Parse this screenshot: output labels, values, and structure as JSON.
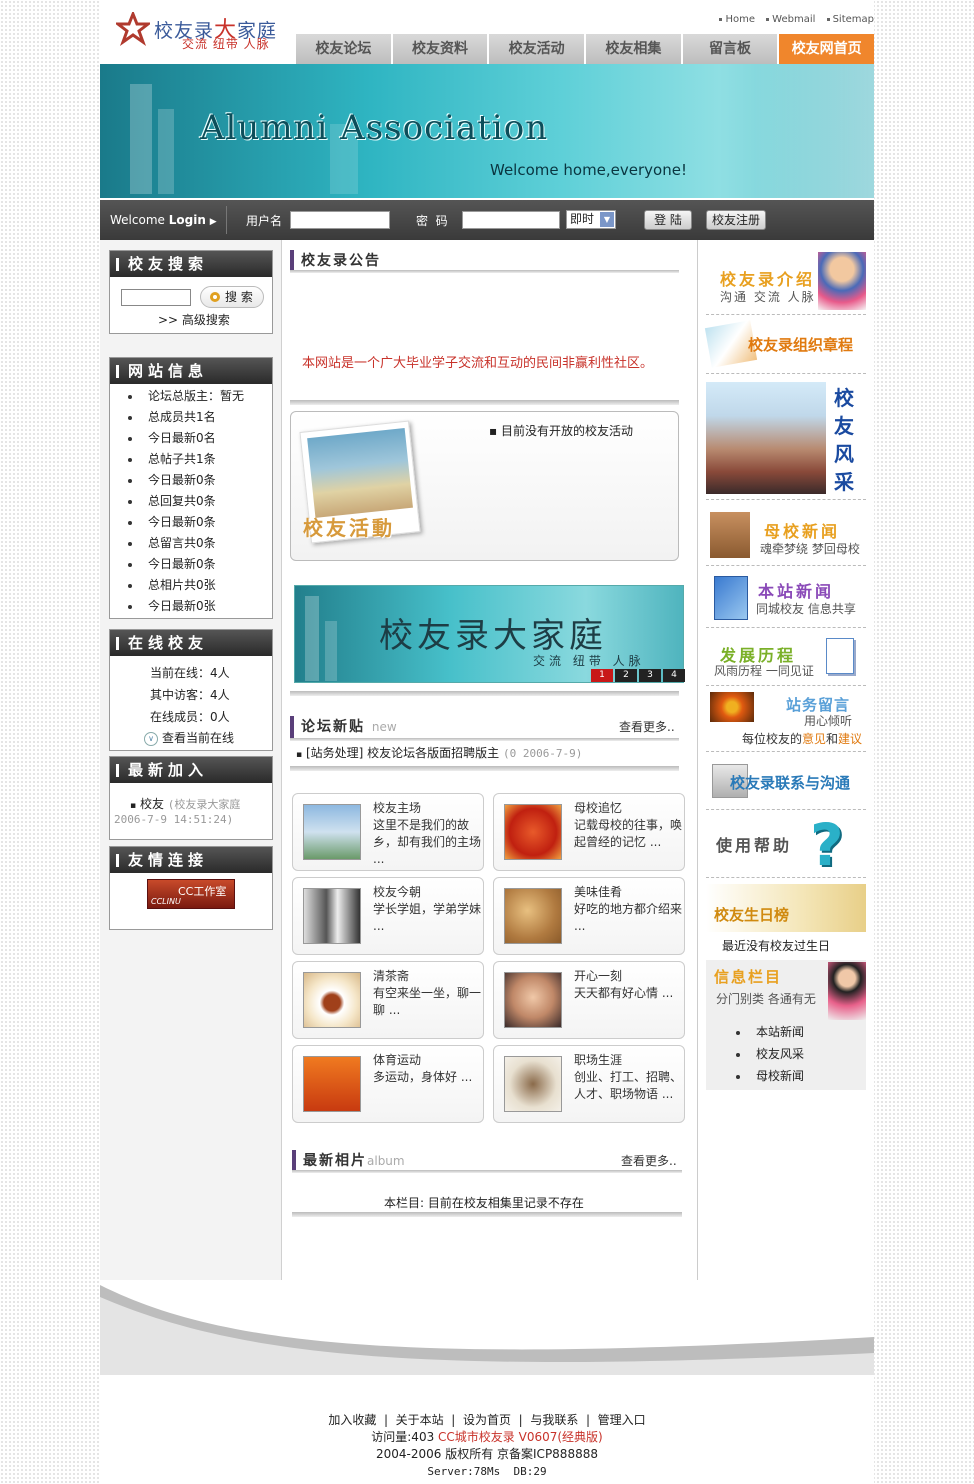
{
  "header": {
    "logo_title_a": "校友录",
    "logo_title_b": "大",
    "logo_title_c": "家庭",
    "logo_sub": "交流 纽带 人脉",
    "toplinks": [
      "Home",
      "Webmail",
      "Sitemap"
    ]
  },
  "nav": [
    "校友论坛",
    "校友资料",
    "校友活动",
    "校友相集",
    "留言板",
    "校友网首页"
  ],
  "banner": {
    "title": "Alumni Association",
    "subtitle": "Welcome home,everyone!"
  },
  "login": {
    "welcome": "Welcome",
    "login_word": "Login",
    "username_label": "用户名",
    "password_label": "密  码",
    "expiry_option": "即时",
    "login_button": "登 陆",
    "register_button": "校友注册"
  },
  "search_box": {
    "title": "校友搜索",
    "search_button": "搜 索",
    "advanced": ">> 高级搜索"
  },
  "site_info": {
    "title": "网站信息",
    "items": [
      "论坛总版主：暂无",
      "总成员共1名",
      "今日最新0名",
      "总帖子共1条",
      "今日最新0条",
      "总回复共0条",
      "今日最新0条",
      "总留言共0条",
      "今日最新0条",
      "总相片共0张",
      "今日最新0张"
    ]
  },
  "online": {
    "title": "在线校友",
    "items": [
      "当前在线：4人",
      "其中访客：4人",
      "在线成员：0人"
    ],
    "view_link": "查看当前在线"
  },
  "newest": {
    "title": "最新加入",
    "name": "校友",
    "detail": "(校友录大家庭",
    "time": "2006-7-9 14:51:24)"
  },
  "links": {
    "title": "友情连接",
    "cc_label": "CC工作室",
    "cc_small": "CCLINU"
  },
  "notice": {
    "title": "校友录公告",
    "text": "本网站是一个广大毕业学子交流和互动的民间非赢利性社区。"
  },
  "activity": {
    "text": "目前没有开放的校友活动",
    "photo_caption": "校友活動"
  },
  "mid_banner": {
    "title": "校友录大家庭",
    "subtitle": "交流 纽带 人脉",
    "pages": [
      "1",
      "2",
      "3",
      "4"
    ]
  },
  "forum": {
    "title": "论坛新贴",
    "title_en": "new",
    "more": "查看更多..",
    "post_text": "[站务处理] 校友论坛各版面招聘版主",
    "post_date": "(0 2006-7-9)"
  },
  "cards": [
    {
      "title": "校友主场",
      "desc": "这里不是我们的故乡，却有我们的主场 ..."
    },
    {
      "title": "母校追忆",
      "desc": "记载母校的往事，唤起曾经的记忆 ..."
    },
    {
      "title": "校友今朝",
      "desc": "学长学姐，学弟学妹 ..."
    },
    {
      "title": "美味佳肴",
      "desc": "好吃的地方都介绍来 ..."
    },
    {
      "title": "清茶斋",
      "desc": "有空来坐一坐，聊一聊 ..."
    },
    {
      "title": "开心一刻",
      "desc": "天天都有好心情 ..."
    },
    {
      "title": "体育运动",
      "desc": "多运动，身体好 ..."
    },
    {
      "title": "职场生涯",
      "desc": "创业、打工、招聘、人才、职场物语 ..."
    }
  ],
  "album": {
    "title": "最新相片",
    "title_en": "album",
    "more": "查看更多..",
    "empty": "本栏目: 目前在校友相集里记录不存在"
  },
  "right": {
    "intro_title": "校友录介绍",
    "intro_sub": "沟通 交流 人脉",
    "charter": "校友录组织章程",
    "style_chars": [
      "校",
      "友",
      "风",
      "采"
    ],
    "school_news": "母校新闻",
    "school_news_sub": "魂牵梦绕 梦回母校",
    "site_news": "本站新闻",
    "site_news_sub": "同城校友 信息共享",
    "history": "发展历程",
    "history_sub": "风雨历程 一同见证",
    "guestbook": "站务留言",
    "guestbook_sub": "用心倾听",
    "guestbook_note_a": "每位校友的",
    "guestbook_note_b": "意见",
    "guestbook_note_c": "和",
    "guestbook_note_d": "建议",
    "contact": "校友录联系与沟通",
    "help": "使用帮助",
    "birthday": "校友生日榜",
    "birthday_note": "最近没有校友过生日",
    "info": "信息栏目",
    "info_sub": "分门别类 各通有无",
    "info_items": [
      "本站新闻",
      "校友风采",
      "母校新闻"
    ]
  },
  "footer": {
    "links": [
      "加入收藏",
      "关于本站",
      "设为首页",
      "与我联系",
      "管理入口"
    ],
    "visits_label": "访问量:403",
    "product": "CC城市校友录 V0607(经典版)",
    "copyright": "2004-2006 版权所有 京备案ICP888888",
    "server": "Server:78Ms  DB:29"
  },
  "colors": {
    "accent": "#f0862c",
    "teal": "#2fb5c2",
    "notice_red": "#c8322a",
    "purple": "#5a3f7a"
  }
}
